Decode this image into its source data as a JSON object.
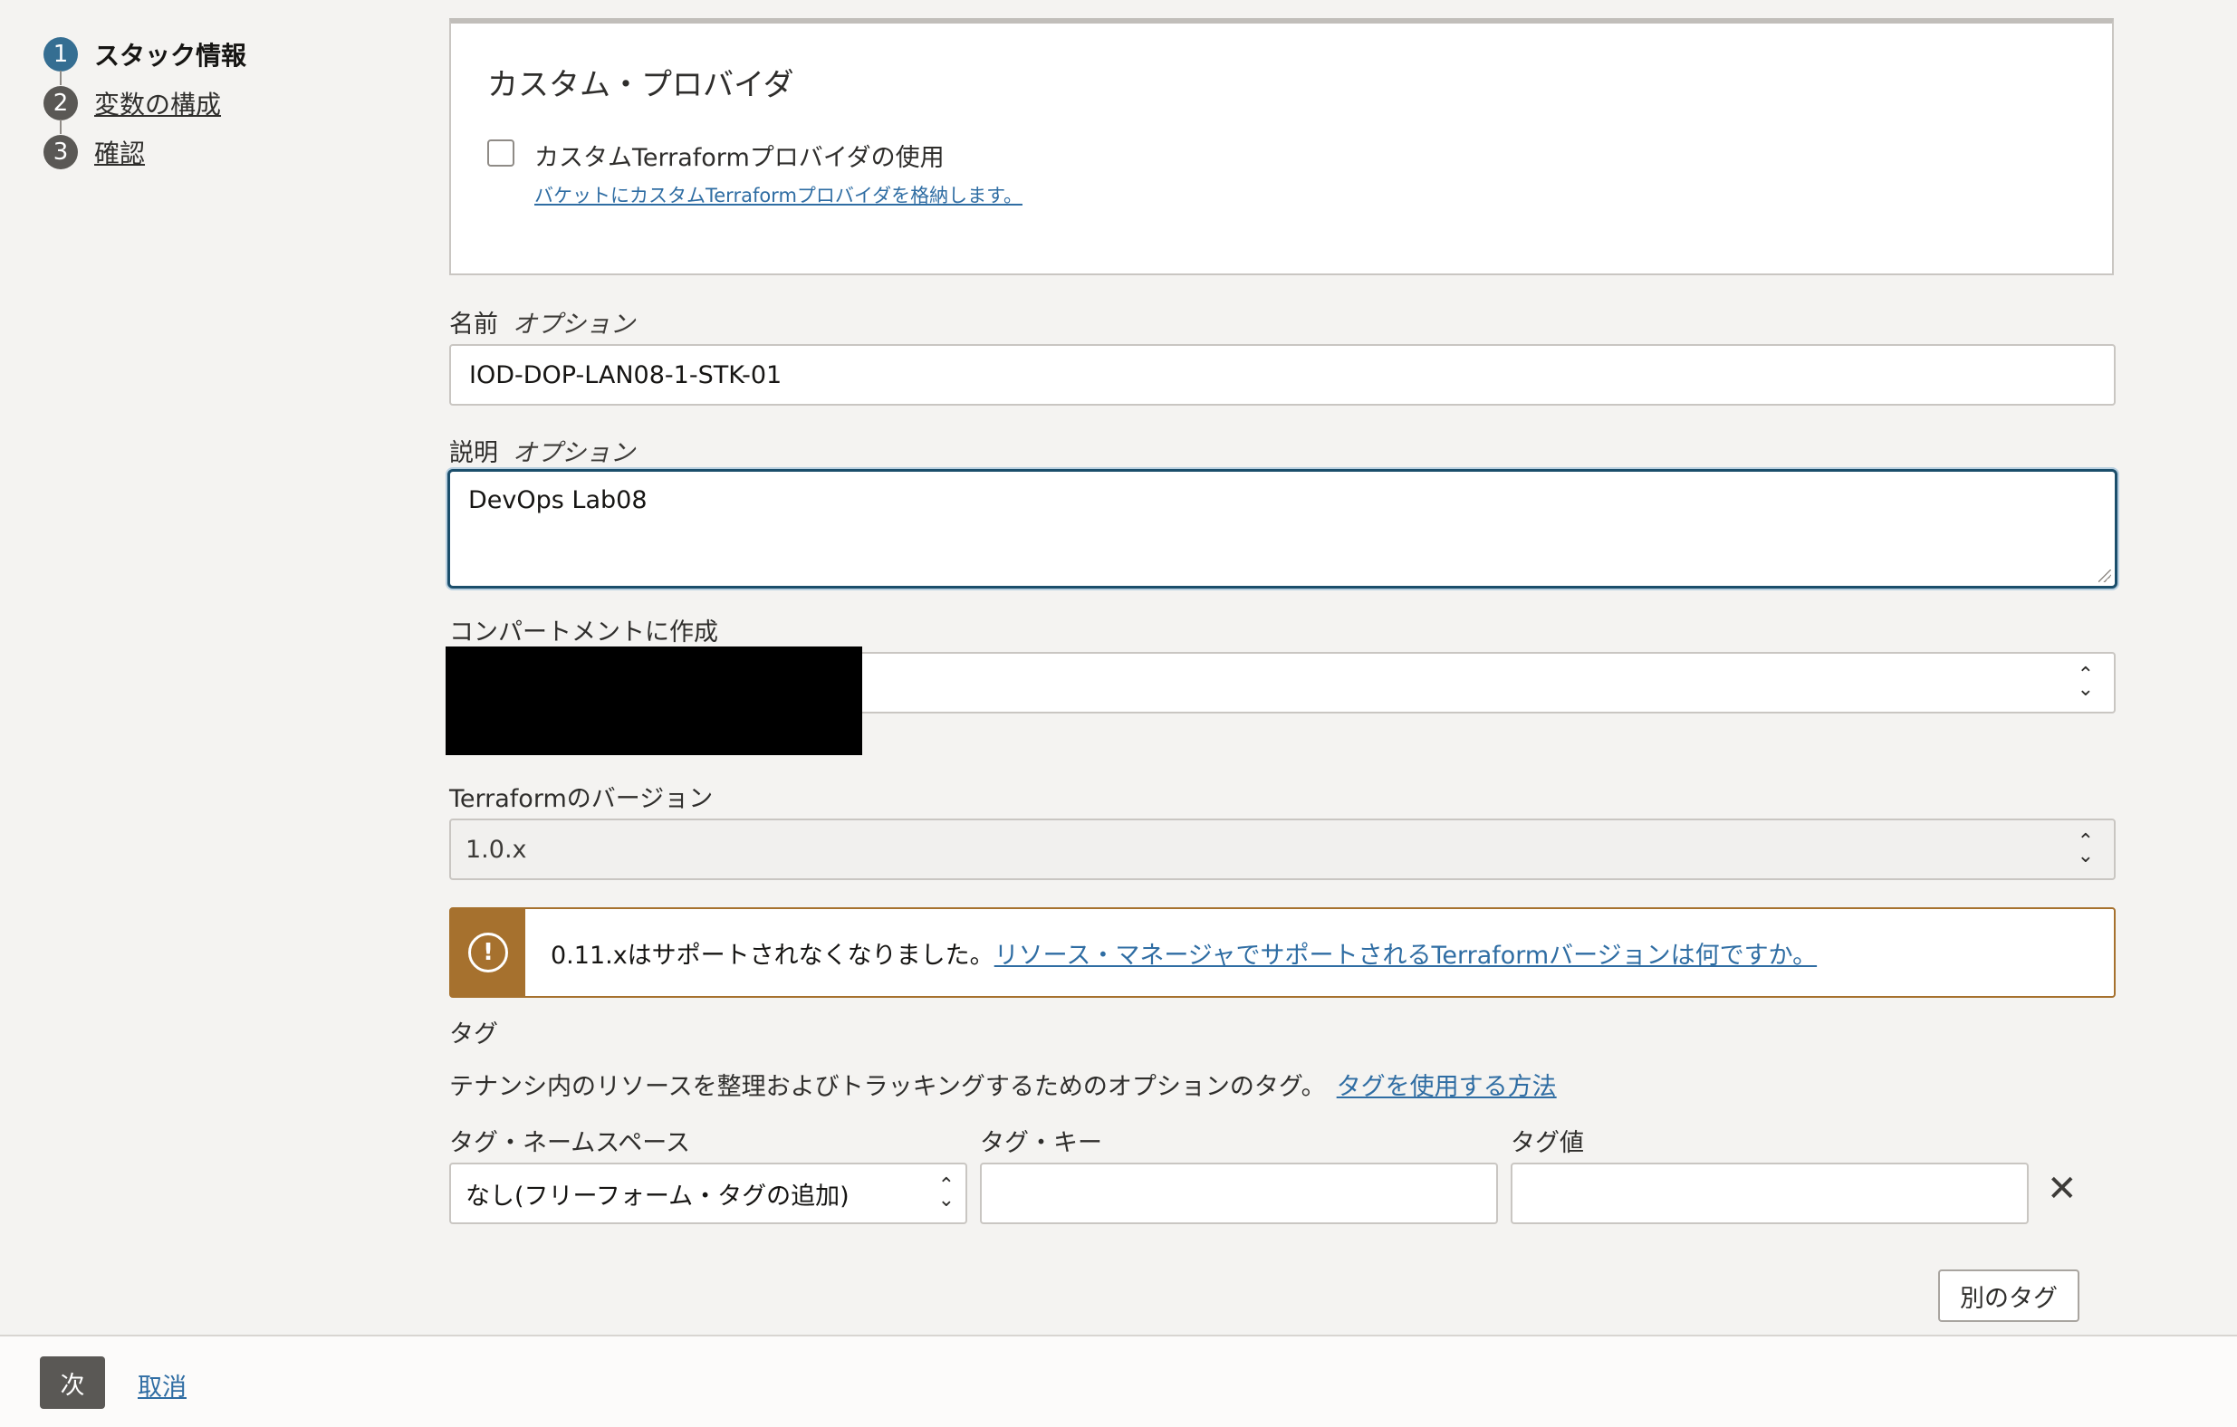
{
  "steps": [
    {
      "num": "1",
      "label": "スタック情報"
    },
    {
      "num": "2",
      "label": "変数の構成"
    },
    {
      "num": "3",
      "label": "確認"
    }
  ],
  "custom_provider": {
    "title": "カスタム・プロバイダ",
    "checkbox_label": "カスタムTerraformプロバイダの使用",
    "help_link": "バケットにカスタムTerraformプロバイダを格納します。"
  },
  "name": {
    "label": "名前",
    "optional": "オプション",
    "value": "IOD-DOP-LAN08-1-STK-01"
  },
  "description": {
    "label": "説明",
    "optional": "オプション",
    "value": "DevOps Lab08"
  },
  "compartment": {
    "label": "コンパートメントに作成"
  },
  "terraform_version": {
    "label": "Terraformのバージョン",
    "value": "1.0.x"
  },
  "warning": {
    "icon": "exclamation-circle-icon",
    "text": "0.11.xはサポートされなくなりました。",
    "link": "リソース・マネージャでサポートされるTerraformバージョンは何ですか。"
  },
  "tags": {
    "heading": "タグ",
    "description": "テナンシ内のリソースを整理およびトラッキングするためのオプションのタグ。",
    "help_link": "タグを使用する方法",
    "namespace_label": "タグ・ネームスペース",
    "namespace_value": "なし(フリーフォーム・タグの追加)",
    "key_label": "タグ・キー",
    "value_label": "タグ値",
    "add_button": "別のタグ"
  },
  "footer": {
    "next": "次",
    "cancel": "取消"
  },
  "colors": {
    "accent": "#356e92",
    "link": "#2f6da3",
    "warning": "#a6712e",
    "background": "#f4f3f1"
  }
}
